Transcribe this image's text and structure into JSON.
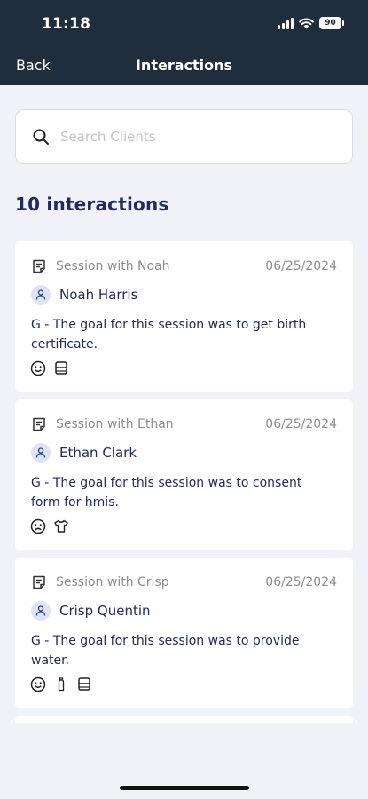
{
  "status_bar": {
    "time": "11:18",
    "battery": "90"
  },
  "nav": {
    "back_label": "Back",
    "title": "Interactions"
  },
  "search": {
    "placeholder": "Search Clients",
    "value": ""
  },
  "summary": {
    "count_label": "10 interactions"
  },
  "interactions": [
    {
      "title": "Session with Noah",
      "date": "06/25/2024",
      "client": "Noah Harris",
      "description": "G - The goal for this session was to get birth certificate.",
      "service_icons": [
        "smiley-face-icon",
        "bus-icon"
      ]
    },
    {
      "title": "Session with Ethan",
      "date": "06/25/2024",
      "client": "Ethan Clark",
      "description": "G - The goal for this session was to consent form for hmis.",
      "service_icons": [
        "sad-face-icon",
        "shirt-icon"
      ]
    },
    {
      "title": "Session with Crisp",
      "date": "06/25/2024",
      "client": "Crisp Quentin",
      "description": "G - The goal for this session was to provide water.",
      "service_icons": [
        "smiley-face-icon",
        "water-bottle-icon",
        "bus-icon"
      ]
    }
  ]
}
